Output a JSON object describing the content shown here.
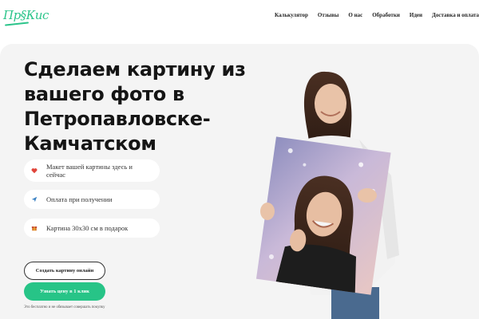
{
  "header": {
    "logo": "Пр§Кис",
    "nav": [
      "Калькулятор",
      "Отзывы",
      "О нас",
      "Обработки",
      "Идеи",
      "Доставка и оплата"
    ]
  },
  "hero": {
    "title": "Сделаем картину из вашего фото в Петропавловске-Камчатском",
    "features": [
      {
        "icon": "heart-icon",
        "text": "Макет вашей картины здесь и сейчас"
      },
      {
        "icon": "plane-icon",
        "text": "Оплата при получении"
      },
      {
        "icon": "gift-icon",
        "text": "Картина 30x30 см в подарок"
      }
    ],
    "create_button": "Создать картину онлайн",
    "price_button": "Узнать цену в 1 клик",
    "note": "Это бесплатно и не обязывает совершать покупку"
  },
  "colors": {
    "accent": "#27c487",
    "hero_bg": "#f4f4f4"
  }
}
